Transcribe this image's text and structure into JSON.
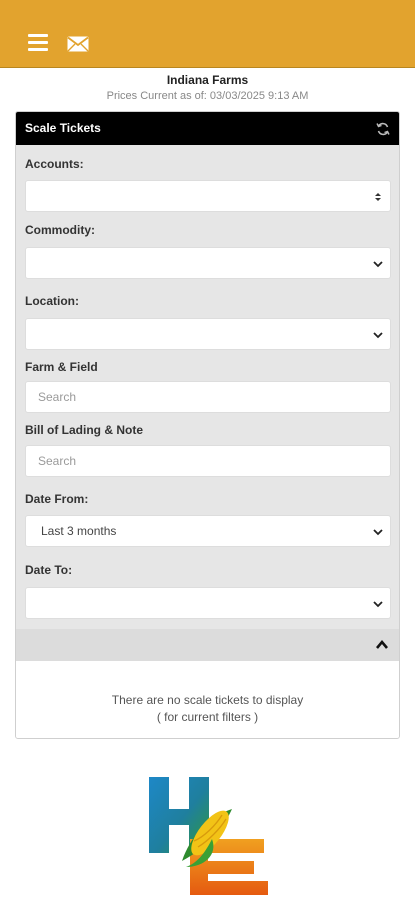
{
  "topbar": {
    "menu_icon": "hamburger-icon",
    "mail_icon": "envelope-icon",
    "accent": "#e2a32e"
  },
  "header": {
    "farm_name": "Indiana Farms",
    "prices_current": "Prices Current as of: 03/03/2025 9:13 AM"
  },
  "panel": {
    "title": "Scale Tickets",
    "refresh_icon": "refresh-icon",
    "fields": {
      "accounts": {
        "label": "Accounts:",
        "value": ""
      },
      "commodity": {
        "label": "Commodity:",
        "value": ""
      },
      "location": {
        "label": "Location:",
        "value": ""
      },
      "farm_field": {
        "label": "Farm & Field",
        "placeholder": "Search"
      },
      "bill_of_lading": {
        "label": "Bill of Lading & Note",
        "placeholder": "Search"
      },
      "date_from": {
        "label": "Date From:",
        "value": "Last 3 months"
      },
      "date_to": {
        "label": "Date To:",
        "value": ""
      }
    },
    "collapse_icon": "chevron-up-icon",
    "empty_message": "There are no scale tickets to display",
    "empty_sub": "( for current filters )"
  },
  "logo": {
    "letters": "HE",
    "icon": "corn-icon"
  }
}
